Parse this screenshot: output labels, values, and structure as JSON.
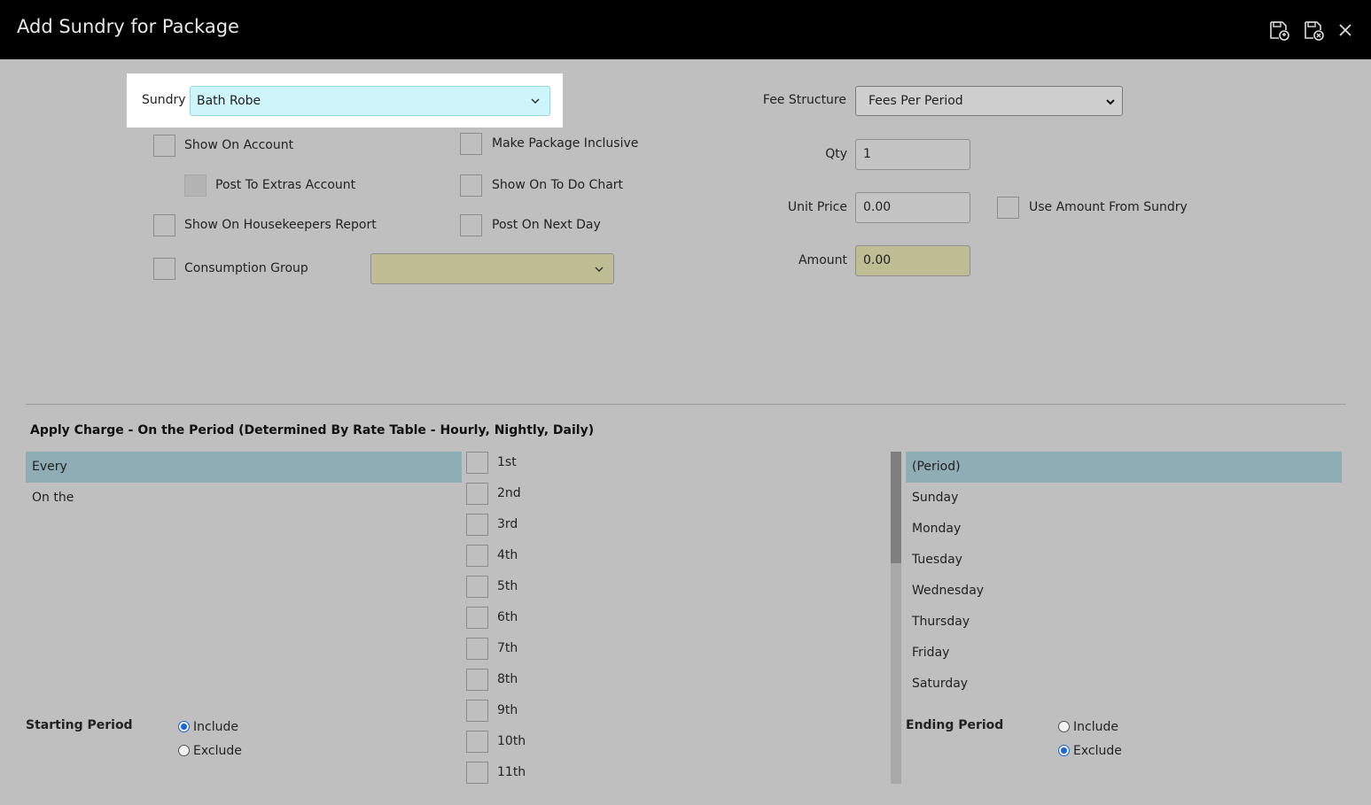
{
  "window": {
    "title": "Add Sundry for Package",
    "icons": [
      "save-and-copy-icon",
      "save-and-close-icon",
      "close-icon"
    ]
  },
  "form": {
    "sundry_label": "Sundry",
    "sundry_value": "Bath Robe",
    "fee_structure_label": "Fee Structure",
    "fee_structure_value": "Fees Per Period",
    "qty_label": "Qty",
    "qty_value": "1",
    "unit_price_label": "Unit Price",
    "unit_price_value": "0.00",
    "use_amount_label": "Use Amount From Sundry",
    "amount_label": "Amount",
    "amount_value": "0.00",
    "consumption_group_value": "",
    "checkboxes": {
      "show_on_account": "Show On Account",
      "post_to_extras": "Post To Extras Account",
      "show_on_housekeepers": "Show On Housekeepers Report",
      "consumption_group": "Consumption Group",
      "make_package_inclusive": "Make Package Inclusive",
      "show_on_todo": "Show On To Do Chart",
      "post_on_next_day": "Post On Next Day"
    }
  },
  "charge": {
    "section_title": "Apply Charge - On the Period (Determined By Rate Table - Hourly, Nightly, Daily)",
    "frequency": [
      "Every",
      "On the"
    ],
    "ordinals": [
      "1st",
      "2nd",
      "3rd",
      "4th",
      "5th",
      "6th",
      "7th",
      "8th",
      "9th",
      "10th",
      "11th"
    ],
    "days": [
      "(Period)",
      "Sunday",
      "Monday",
      "Tuesday",
      "Wednesday",
      "Thursday",
      "Friday",
      "Saturday"
    ],
    "starting_period_label": "Starting Period",
    "ending_period_label": "Ending Period",
    "include_label": "Include",
    "exclude_label": "Exclude",
    "starting_selected": "Include",
    "ending_selected": "Exclude"
  }
}
